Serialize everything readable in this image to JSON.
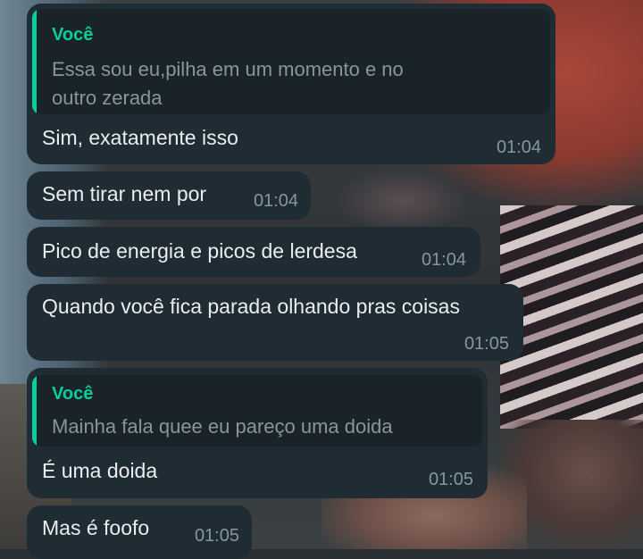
{
  "messages": [
    {
      "quote": {
        "author": "Você",
        "lines": [
          "Essa sou eu,pilha em um momento e no",
          "outro zerada"
        ]
      },
      "text": "Sim, exatamente isso",
      "time": "01:04"
    },
    {
      "text": "Sem tirar nem por",
      "time": "01:04"
    },
    {
      "text": "Pico de energia e picos de lerdesa",
      "time": "01:04"
    },
    {
      "text": "Quando você fica parada olhando pras coisas",
      "time": "01:05"
    },
    {
      "quote": {
        "author": "Você",
        "lines": [
          "Mainha fala quee eu pareço uma doida"
        ]
      },
      "text": "É uma doida",
      "time": "01:05"
    },
    {
      "text": "Mas é foofo",
      "time": "01:05"
    }
  ]
}
